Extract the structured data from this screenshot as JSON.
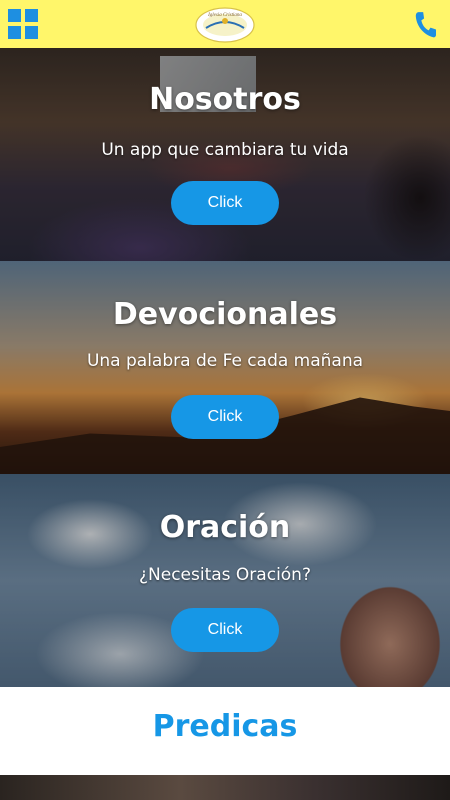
{
  "header": {
    "menu_icon": "grid-menu-icon",
    "logo_text": "Iglesia Cristiana",
    "logo_alt": "church-logo",
    "phone_icon": "phone-icon",
    "colors": {
      "background": "#FFF66A",
      "accent": "#1E8FE1"
    }
  },
  "sections": [
    {
      "title": "Nosotros",
      "subtitle": "Un app que cambiara tu vida",
      "button": "Click"
    },
    {
      "title": "Devocionales",
      "subtitle": "Una palabra de Fe cada mañana",
      "button": "Click"
    },
    {
      "title": "Oración",
      "subtitle": "¿Necesitas Oración?",
      "button": "Click"
    }
  ],
  "predicas": {
    "title": "Predicas",
    "color": "#1697E6"
  },
  "button_color": "#1697E6"
}
